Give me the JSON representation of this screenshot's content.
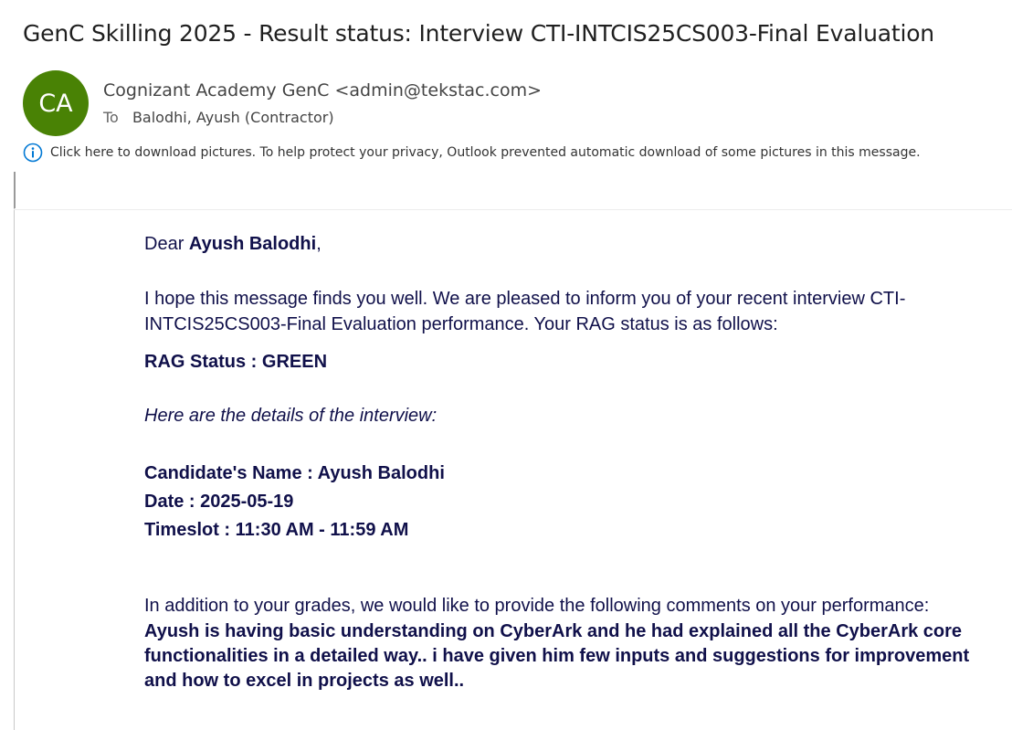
{
  "email": {
    "subject": "GenC Skilling 2025 - Result status: Interview CTI-INTCIS25CS003-Final Evaluation",
    "sender": {
      "initials": "CA",
      "avatar_color": "#498205",
      "display": "Cognizant Academy GenC <admin@tekstac.com>"
    },
    "to_label": "To",
    "recipient": "Balodhi, Ayush (Contractor)",
    "info_icon": "info-icon",
    "info_message": "Click here to download pictures. To help protect your privacy, Outlook prevented automatic download of some pictures in this message."
  },
  "body": {
    "greeting_prefix": "Dear ",
    "greeting_name": "Ayush Balodhi",
    "greeting_suffix": ",",
    "intro": "I hope this message finds you well. We are pleased to inform you of your recent interview CTI-INTCIS25CS003-Final Evaluation performance. Your RAG status is as follows:",
    "rag_status": "RAG Status : GREEN",
    "details_intro": "Here are the details of the interview:",
    "candidate_name": "Candidate's Name : Ayush Balodhi",
    "date": "Date : 2025-05-19",
    "timeslot": "Timeslot : 11:30 AM - 11:59 AM",
    "comments_intro": "In addition to your grades, we would like to provide the following comments on your performance:",
    "comments": "Ayush is having basic understanding on CyberArk and he had explained all the CyberArk core functionalities in a detailed way.. i have given him few inputs and suggestions for improvement and how to excel in projects as well.."
  }
}
